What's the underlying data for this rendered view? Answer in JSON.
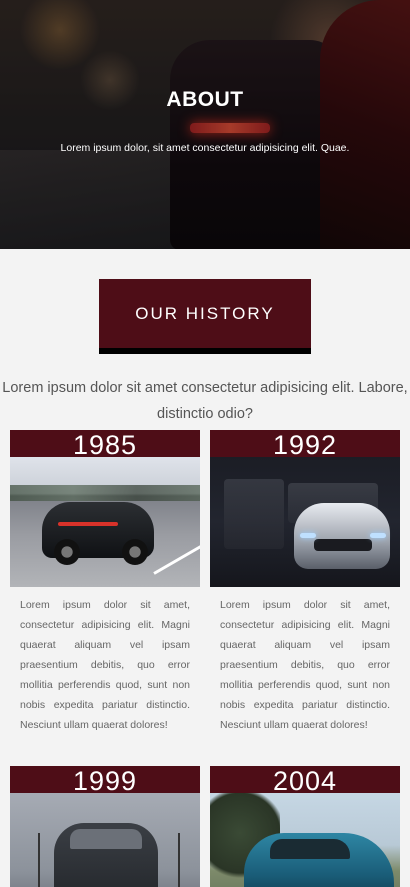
{
  "hero": {
    "title": "ABOUT",
    "subtitle": "Lorem ipsum dolor, sit amet consectetur adipisicing elit. Quae."
  },
  "history": {
    "button_label": "OUR HISTORY",
    "intro": "Lorem ipsum dolor sit amet consectetur adipisicing elit. Labore, distinctio odio?"
  },
  "cards": [
    {
      "year": "1985",
      "text": "Lorem ipsum dolor sit amet, consectetur adipisicing elit. Magni quaerat aliquam vel ipsam praesentium debitis, quo error mollitia perferendis quod, sunt non nobis expedita pariatur distinctio. Nesciunt ullam quaerat dolores!"
    },
    {
      "year": "1992",
      "text": "Lorem ipsum dolor sit amet, consectetur adipisicing elit. Magni quaerat aliquam vel ipsam praesentium debitis, quo error mollitia perferendis quod, sunt non nobis expedita pariatur distinctio. Nesciunt ullam quaerat dolores!"
    },
    {
      "year": "1999",
      "text": ""
    },
    {
      "year": "2004",
      "text": ""
    }
  ],
  "colors": {
    "accent": "#4e0d17",
    "background": "#f3f3f3"
  }
}
